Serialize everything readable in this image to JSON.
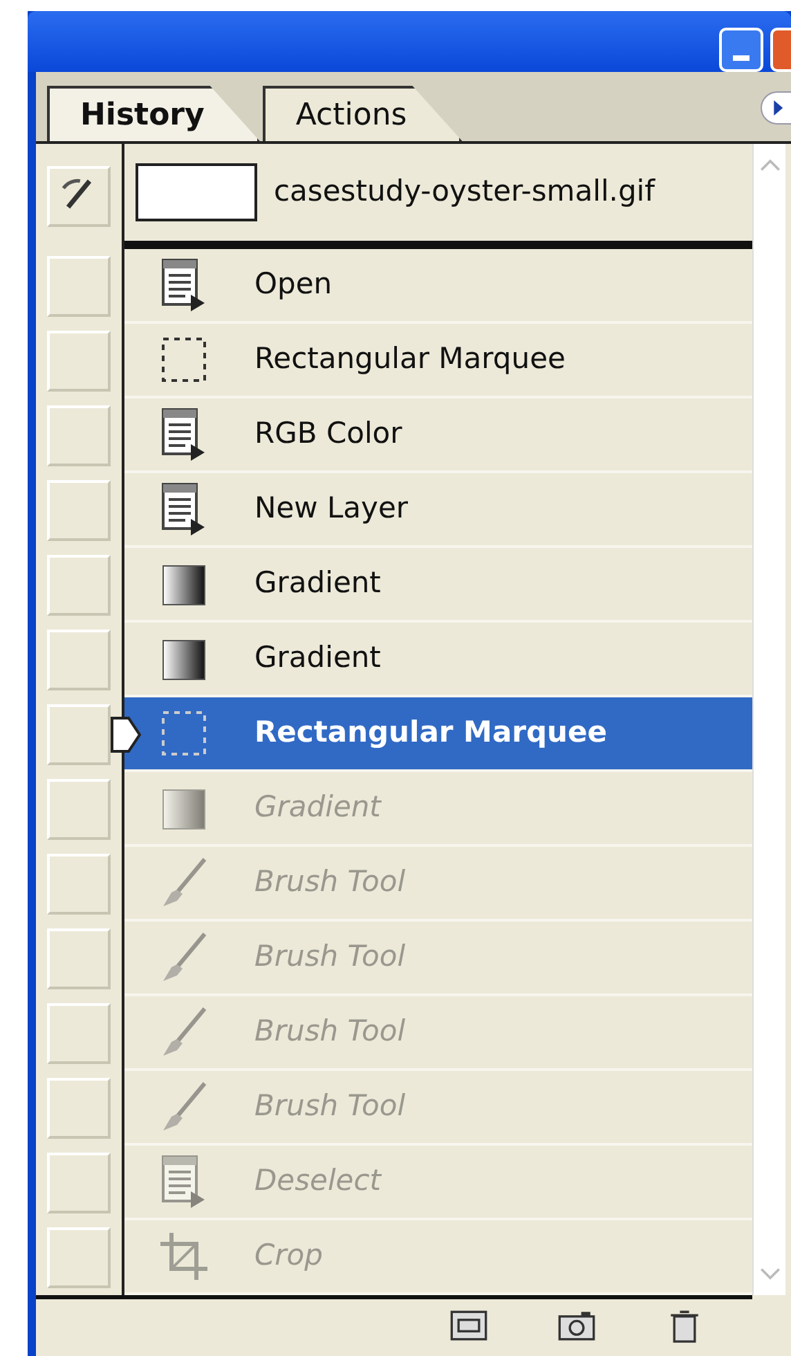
{
  "tabs": [
    {
      "label": "History",
      "selected": true
    },
    {
      "label": "Actions",
      "selected": false
    }
  ],
  "snapshot": {
    "name": "casestudy-oyster-small.gif"
  },
  "steps": [
    {
      "kind": "document",
      "label": "Open",
      "selected": false,
      "undone": false
    },
    {
      "kind": "marquee",
      "label": "Rectangular Marquee",
      "selected": false,
      "undone": false
    },
    {
      "kind": "document",
      "label": "RGB Color",
      "selected": false,
      "undone": false
    },
    {
      "kind": "document",
      "label": "New Layer",
      "selected": false,
      "undone": false
    },
    {
      "kind": "gradient",
      "label": "Gradient",
      "selected": false,
      "undone": false
    },
    {
      "kind": "gradient",
      "label": "Gradient",
      "selected": false,
      "undone": false
    },
    {
      "kind": "marquee",
      "label": "Rectangular Marquee",
      "selected": true,
      "undone": false
    },
    {
      "kind": "gradient",
      "label": "Gradient",
      "selected": false,
      "undone": true
    },
    {
      "kind": "brush",
      "label": "Brush Tool",
      "selected": false,
      "undone": true
    },
    {
      "kind": "brush",
      "label": "Brush Tool",
      "selected": false,
      "undone": true
    },
    {
      "kind": "brush",
      "label": "Brush Tool",
      "selected": false,
      "undone": true
    },
    {
      "kind": "brush",
      "label": "Brush Tool",
      "selected": false,
      "undone": true
    },
    {
      "kind": "document",
      "label": "Deselect",
      "selected": false,
      "undone": true
    },
    {
      "kind": "crop",
      "label": "Crop",
      "selected": false,
      "undone": true
    }
  ]
}
